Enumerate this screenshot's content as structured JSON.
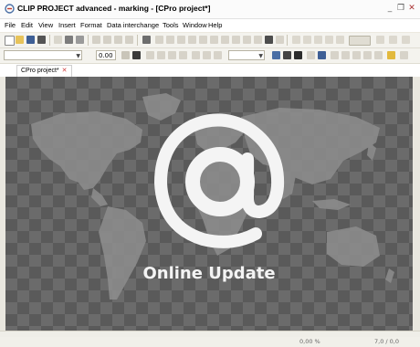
{
  "window": {
    "title": "CLIP PROJECT advanced - marking - [CPro project*]",
    "minimize_glyph": "_",
    "restore_glyph": "❐",
    "close_glyph": "✕"
  },
  "menu": {
    "items": [
      "File",
      "Edit",
      "View",
      "Insert",
      "Format",
      "Data interchange",
      "Tools",
      "Window",
      "Help"
    ]
  },
  "toolbar2": {
    "font_combo_value": "",
    "size_combo_value": "0.00"
  },
  "document_tab": {
    "label": "CPro project*",
    "close_glyph": "✕"
  },
  "splash": {
    "caption": "Online Update",
    "logo_icon": "at-sign-icon"
  },
  "statusbar": {
    "left_text": "0,00 %",
    "right_text": "7,0 / 0,0"
  },
  "colors": {
    "workspace_dark": "#5a5a5a",
    "workspace_light": "#6b6b6b",
    "continent": "#8c8c8c",
    "logo": "#f4f4f4"
  }
}
